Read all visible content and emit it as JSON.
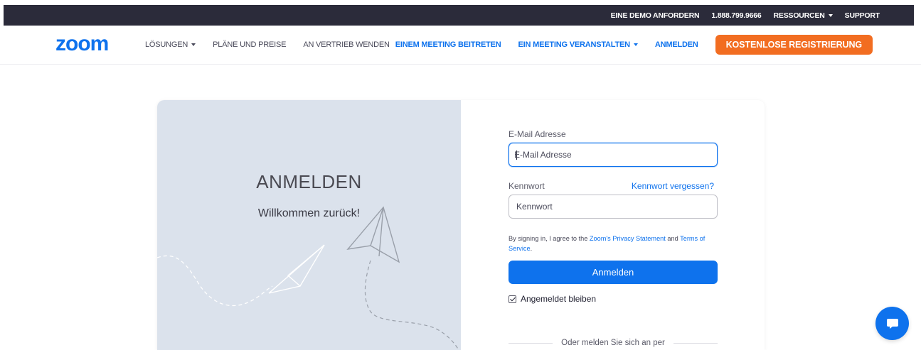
{
  "topbar": {
    "demo": "EINE DEMO ANFORDERN",
    "phone": "1.888.799.9666",
    "resources": "RESSOURCEN",
    "support": "SUPPORT"
  },
  "nav": {
    "logo": "zoom",
    "solutions": "LÖSUNGEN",
    "plans": "PLÄNE UND PREISE",
    "sales": "AN VERTRIEB WENDEN",
    "join": "EINEM MEETING BEITRETEN",
    "host": "EIN MEETING VERANSTALTEN",
    "signin": "ANMELDEN",
    "signup": "KOSTENLOSE REGISTRIERUNG"
  },
  "hero": {
    "heading": "ANMELDEN",
    "welcome": "Willkommen zurück!"
  },
  "form": {
    "email_label": "E-Mail Adresse",
    "email_placeholder": "E-Mail Adresse",
    "password_label": "Kennwort",
    "forgot": "Kennwort vergessen?",
    "password_placeholder": "Kennwort",
    "terms_prefix": "By signing in, I agree to the ",
    "privacy_link": "Zoom's Privacy Statement",
    "terms_and": " and ",
    "terms_link": "Terms of Service",
    "terms_suffix": ".",
    "submit": "Anmelden",
    "keep_signed_in": "Angemeldet bleiben",
    "keep_signed_in_checked": true,
    "or_signin_with": "Oder melden Sie sich an per"
  },
  "colors": {
    "brand_blue": "#0e72ed",
    "signup_orange": "#f26d21",
    "topbar_dark": "#2b2b3a",
    "hero_panel": "#dbe2ec"
  },
  "icons": {
    "chat": "chat-bubble-icon",
    "plane": "paper-plane-icon"
  }
}
